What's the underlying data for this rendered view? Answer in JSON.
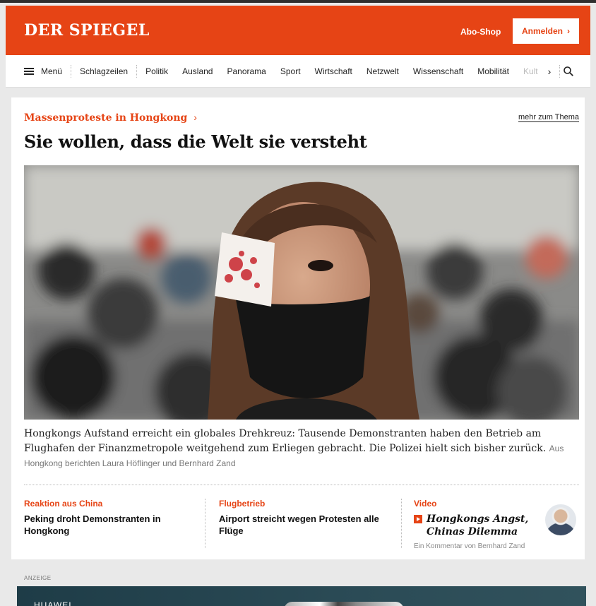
{
  "header": {
    "logo": "DER SPIEGEL",
    "abo_shop": "Abo-Shop",
    "anmelden": "Anmelden",
    "brand_color": "#e64415"
  },
  "nav": {
    "menu_label": "Menü",
    "items": [
      "Schlagzeilen",
      "Politik",
      "Ausland",
      "Panorama",
      "Sport",
      "Wirtschaft",
      "Netzwelt",
      "Wissenschaft",
      "Mobilität"
    ],
    "overflow_item": "Kult",
    "more_arrow": "›",
    "search_icon": "search-icon"
  },
  "article": {
    "kicker": "Massenproteste in Hongkong",
    "kicker_arrow": "›",
    "mehr_zum_thema": "mehr zum Thema",
    "headline": "Sie wollen, dass die Welt sie versteht",
    "teaser": "Hongkongs Aufstand erreicht ein globales Drehkreuz: Tausende Demonstranten haben den Betrieb am Flughafen der Finanzmetropole weitgehend zum Erliegen gebracht. Die Polizei hielt sich bisher zurück.",
    "byline": "Aus Hongkong berichten Laura Höflinger und Bernhard Zand"
  },
  "related": [
    {
      "label": "Reaktion aus China",
      "title": "Peking droht Demonstranten in Hongkong"
    },
    {
      "label": "Flugbetrieb",
      "title": "Airport streicht wegen Protesten alle Flüge"
    }
  ],
  "video": {
    "label": "Video",
    "title": "Hongkongs Angst, Chinas Dilemma",
    "byline": "Ein Kommentar von Bernhard Zand"
  },
  "ad": {
    "label": "ANZEIGE",
    "logo_text": "HUAWEI"
  }
}
